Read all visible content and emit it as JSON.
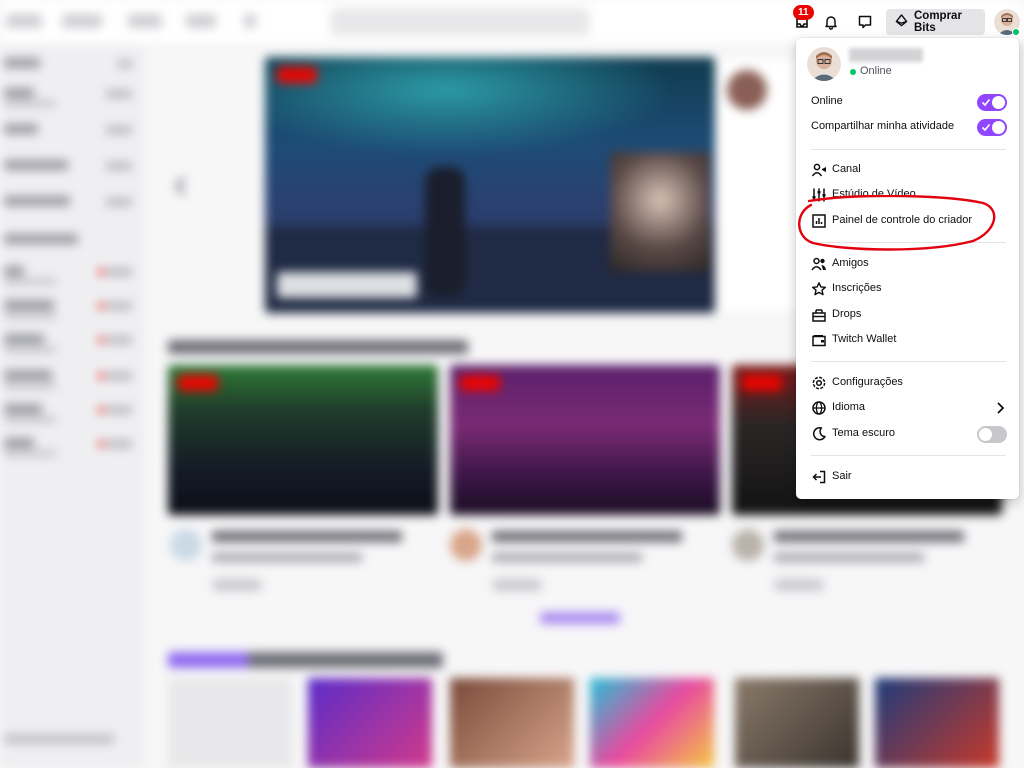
{
  "notifications": {
    "count": "11"
  },
  "topbar": {
    "bits_label": "Comprar Bits"
  },
  "colors": {
    "accent": "#9147ff",
    "badge": "#eb0400",
    "online": "#00c26a",
    "annotation": "#e3000f"
  },
  "icons": {
    "notifications": "inbox-icon",
    "alerts": "bell-icon",
    "whispers": "chat-bubble-icon",
    "bits": "bits-diamond-icon"
  },
  "menu": {
    "profile": {
      "status": "Online"
    },
    "toggles": [
      {
        "label": "Online",
        "state": "on"
      },
      {
        "label": "Compartilhar minha atividade",
        "state": "on"
      }
    ],
    "creator": [
      {
        "label": "Canal",
        "icon": "channel-person-icon"
      },
      {
        "label": "Estúdio de Vídeo",
        "icon": "video-studio-sliders-icon"
      },
      {
        "label": "Painel de controle do criador",
        "icon": "creator-dashboard-icon"
      }
    ],
    "social": [
      {
        "label": "Amigos",
        "icon": "friends-icon"
      },
      {
        "label": "Inscrições",
        "icon": "star-icon"
      },
      {
        "label": "Drops",
        "icon": "drops-gift-icon"
      },
      {
        "label": "Twitch Wallet",
        "icon": "wallet-icon"
      }
    ],
    "settings": [
      {
        "label": "Configurações",
        "icon": "gear-icon"
      },
      {
        "label": "Idioma",
        "icon": "globe-icon"
      },
      {
        "label": "Tema escuro",
        "icon": "moon-icon",
        "toggle": "off"
      }
    ],
    "logout": {
      "label": "Sair",
      "icon": "logout-icon"
    }
  }
}
